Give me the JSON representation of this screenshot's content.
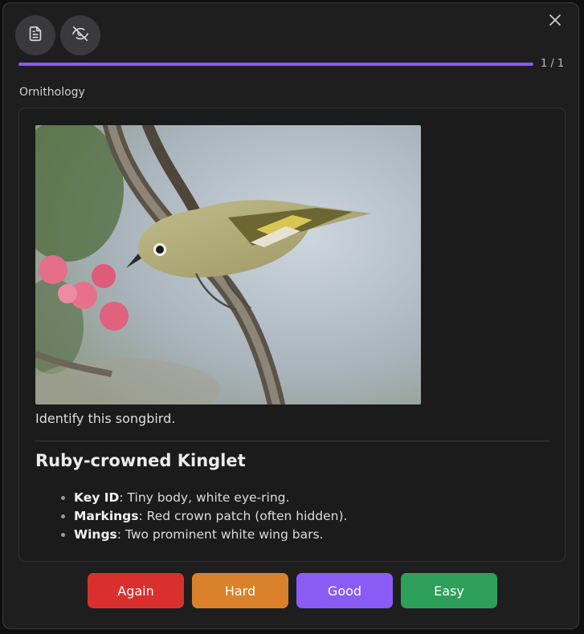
{
  "toolbar": {
    "note_icon": "document-icon",
    "hide_icon": "eye-off-icon",
    "close_icon": "close-icon"
  },
  "progress": {
    "fraction": 1.0,
    "count_text": "1 / 1",
    "color": "#8a5cf5"
  },
  "deck": {
    "name": "Ornithology"
  },
  "card": {
    "image": "photo of a small olive-green songbird perched on a branch",
    "question": "Identify this songbird.",
    "answer_title": "Ruby-crowned Kinglet",
    "facts": [
      {
        "label": "Key ID",
        "text": ": Tiny body, white eye-ring."
      },
      {
        "label": "Markings",
        "text": ": Red crown patch (often hidden)."
      },
      {
        "label": "Wings",
        "text": ": Two prominent white wing bars."
      }
    ]
  },
  "buttons": [
    {
      "label": "Again",
      "color": "#d9302e"
    },
    {
      "label": "Hard",
      "color": "#d9822b"
    },
    {
      "label": "Good",
      "color": "#8a5cf5"
    },
    {
      "label": "Easy",
      "color": "#2e9e5b"
    }
  ]
}
